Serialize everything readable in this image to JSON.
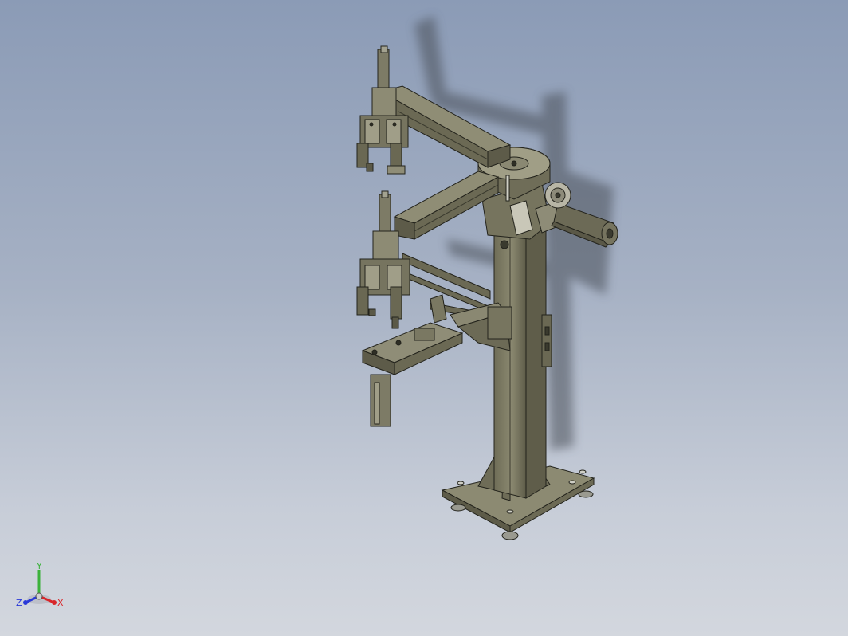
{
  "viewport": {
    "background_top": "#8b9bb6",
    "background_bottom": "#d3d7de",
    "model_color": "#7d7b63",
    "edge_color": "#23231c",
    "shadow_color": "#4a4f58"
  },
  "triad": {
    "x_label": "X",
    "y_label": "Y",
    "z_label": "Z",
    "x_color": "#d8262a",
    "y_color": "#3bb23b",
    "z_color": "#2a39d8"
  }
}
